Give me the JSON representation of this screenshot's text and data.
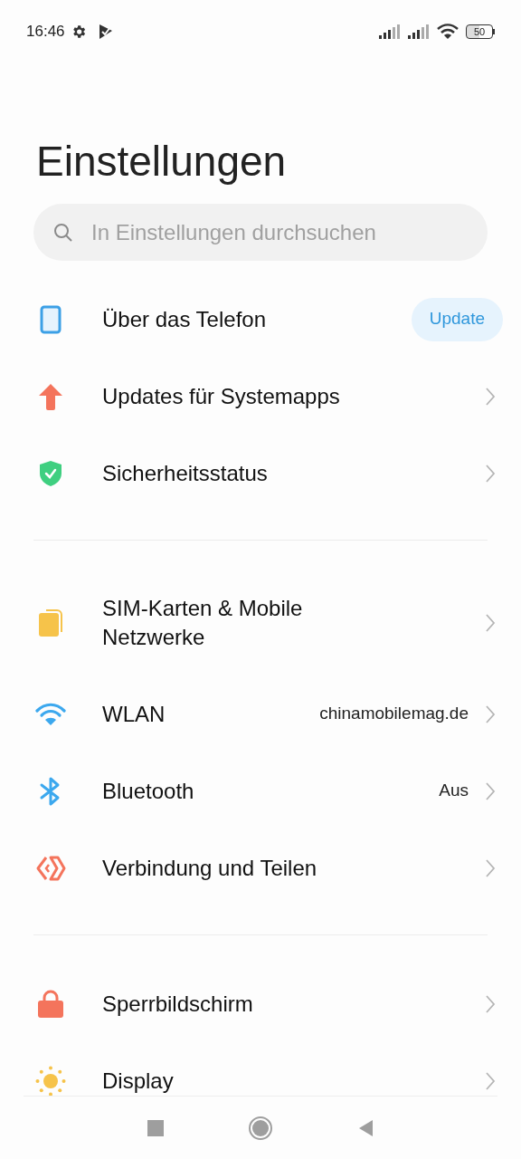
{
  "status_bar": {
    "time": "16:46",
    "battery": "50"
  },
  "title": "Einstellungen",
  "search": {
    "placeholder": "In Einstellungen durchsuchen"
  },
  "sections": [
    {
      "items": [
        {
          "label": "Über das Telefon",
          "kind": "button",
          "action": "Update"
        },
        {
          "label": "Updates für Systemapps",
          "kind": "link"
        },
        {
          "label": "Sicherheitsstatus",
          "kind": "link"
        }
      ]
    },
    {
      "items": [
        {
          "label": "SIM-Karten & Mobile Netzwerke",
          "kind": "link"
        },
        {
          "label": "WLAN",
          "kind": "link",
          "value": "chinamobilemag.de"
        },
        {
          "label": "Bluetooth",
          "kind": "link",
          "value": "Aus"
        },
        {
          "label": "Verbindung und Teilen",
          "kind": "link"
        }
      ]
    },
    {
      "items": [
        {
          "label": "Sperrbildschirm",
          "kind": "link"
        },
        {
          "label": "Display",
          "kind": "link"
        }
      ]
    }
  ]
}
